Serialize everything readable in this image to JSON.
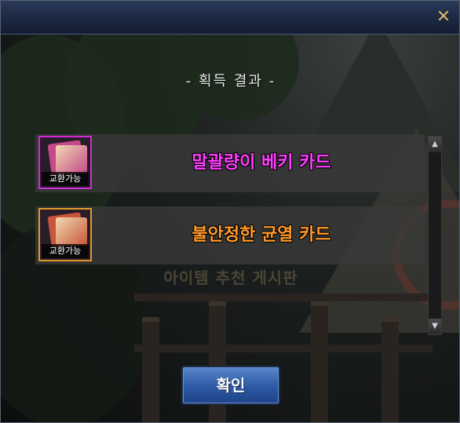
{
  "dialog": {
    "heading": "- 획득 결과 -",
    "confirm_label": "확인",
    "close_icon": "close-icon"
  },
  "items": [
    {
      "name": "말괄량이 베키 카드",
      "badge": "교환가능",
      "name_color": "#ff3dff",
      "frame_color": "#d02bd6",
      "card_color": "#c44a8a"
    },
    {
      "name": "불안정한 균열 카드",
      "badge": "교환가능",
      "name_color": "#ff9a2a",
      "frame_color": "#e09a2a",
      "card_color": "#c8563a"
    }
  ],
  "watermark_text": "아이템 추천 게시판",
  "scrollbar": {
    "up_icon": "chevron-up-icon",
    "down_icon": "chevron-down-icon"
  }
}
